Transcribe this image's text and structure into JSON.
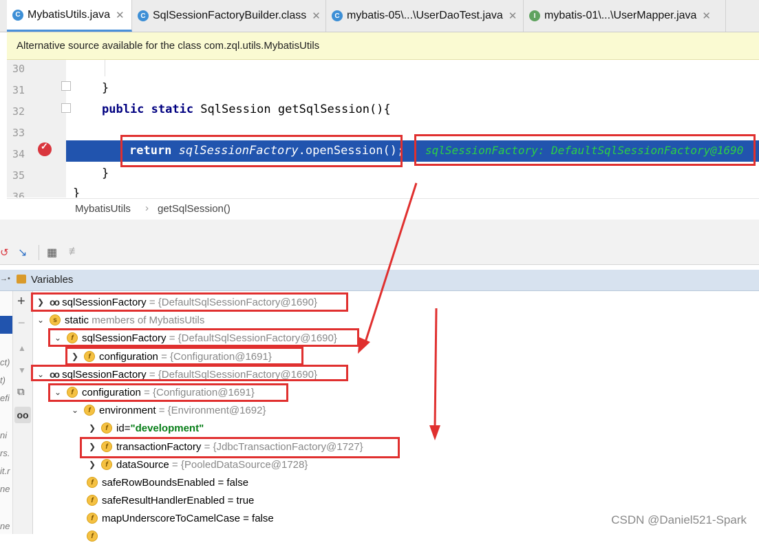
{
  "tabs": [
    {
      "label": "MybatisUtils.java",
      "icon": "class-c-icon",
      "color": "#3d8fd6"
    },
    {
      "label": "SqlSessionFactoryBuilder.class",
      "icon": "class-c-icon",
      "color": "#3d8fd6"
    },
    {
      "label": "mybatis-05\\...\\UserDaoTest.java",
      "icon": "test-class-icon",
      "color": "#3d8fd6"
    },
    {
      "label": "mybatis-01\\...\\UserMapper.java",
      "icon": "interface-i-icon",
      "color": "#5fa35f"
    }
  ],
  "banner": "Alternative source available for the class com.zql.utils.MybatisUtils",
  "editor": {
    "lines": [
      {
        "num": "30",
        "text": ""
      },
      {
        "num": "31",
        "text": "}"
      },
      {
        "num": "32",
        "kw": "public static",
        "type": " SqlSession ",
        "method": "getSqlSession(){"
      },
      {
        "num": "33",
        "text": ""
      },
      {
        "num": "34",
        "kw": "return",
        "field": "sqlSessionFactory",
        "rest": ".openSession();"
      },
      {
        "num": "35",
        "text": "}"
      },
      {
        "num": "36",
        "text": "}"
      }
    ],
    "inline_hint": "sqlSessionFactory: DefaultSqlSessionFactory@1690"
  },
  "breadcrumb": [
    "MybatisUtils",
    "getSqlSession()"
  ],
  "variables_title": "Variables",
  "tree": [
    {
      "name": "sqlSessionFactory",
      "value": "= {DefaultSqlSessionFactory@1690}"
    },
    {
      "name": "static",
      "value": "members of MybatisUtils"
    },
    {
      "name": "sqlSessionFactory",
      "value": "= {DefaultSqlSessionFactory@1690}"
    },
    {
      "name": "configuration",
      "value": "= {Configuration@1691}"
    },
    {
      "name": "sqlSessionFactory",
      "value": "= {DefaultSqlSessionFactory@1690}"
    },
    {
      "name": "configuration",
      "value": "= {Configuration@1691}"
    },
    {
      "name": "environment",
      "value": "= {Environment@1692}"
    },
    {
      "name": "id",
      "eq": " = ",
      "value": "\"development\""
    },
    {
      "name": "transactionFactory",
      "value": "= {JdbcTransactionFactory@1727}"
    },
    {
      "name": "dataSource",
      "value": "= {PooledDataSource@1728}"
    },
    {
      "name": "safeRowBoundsEnabled",
      "value": "= false"
    },
    {
      "name": "safeResultHandlerEnabled",
      "value": "= true"
    },
    {
      "name": "mapUnderscoreToCamelCase",
      "value": "= false"
    }
  ],
  "side_fragments": [
    "ct)",
    "t)",
    "efi",
    "ni",
    "rs.",
    "it.r",
    "ne",
    "ne"
  ],
  "watermark": "CSDN @Daniel521-Spark"
}
